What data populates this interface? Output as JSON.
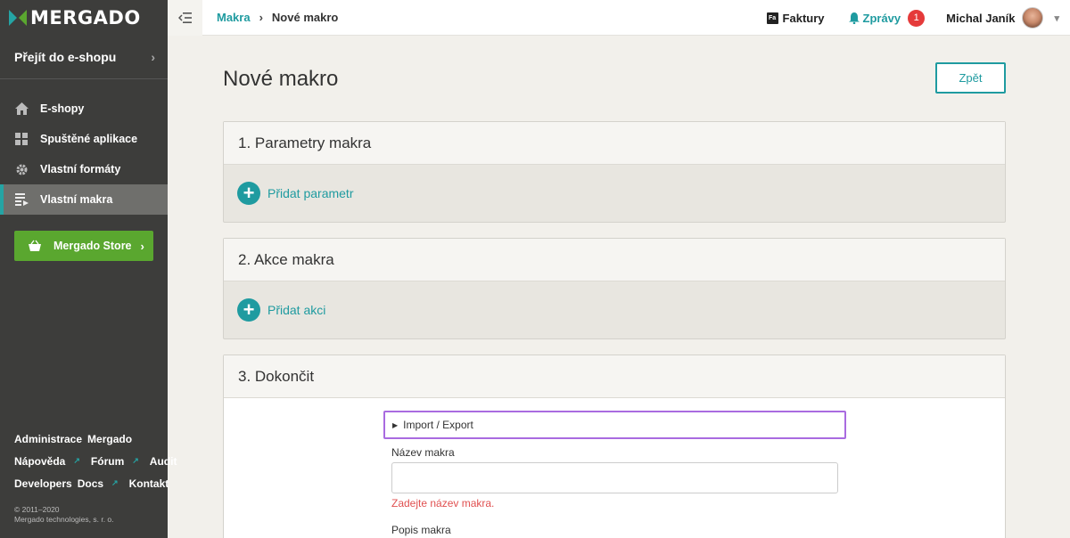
{
  "app": {
    "logo_text": "MERGADO"
  },
  "sidebar": {
    "shop_link": "Přejít do e-shopu",
    "items": [
      {
        "label": "E-shopy",
        "icon": "home-icon"
      },
      {
        "label": "Spuštěné aplikace",
        "icon": "grid-icon"
      },
      {
        "label": "Vlastní formáty",
        "icon": "gear-icon"
      },
      {
        "label": "Vlastní makra",
        "icon": "macro-list-icon",
        "active": true
      }
    ],
    "store_button": "Mergado Store",
    "footer_links": {
      "row1": [
        "Administrace",
        "Mergado"
      ],
      "row2": [
        "Nápověda",
        "Fórum",
        "Audit"
      ],
      "row3": [
        "Developers",
        "Docs",
        "Kontakt"
      ]
    },
    "copyright_years": "© 2011–2020",
    "copyright_company": "Mergado technologies, s. r. o."
  },
  "topbar": {
    "breadcrumb": {
      "parent": "Makra",
      "current": "Nové makro"
    },
    "faktury_icon_text": "Fa",
    "faktury": "Faktury",
    "zpravy": "Zprávy",
    "zpravy_count": "1",
    "user_name": "Michal Janík"
  },
  "main": {
    "title": "Nové makro",
    "back_button": "Zpět",
    "section1": {
      "title": "1. Parametry makra",
      "add_label": "Přidat parametr"
    },
    "section2": {
      "title": "2. Akce makra",
      "add_label": "Přidat akci"
    },
    "section3": {
      "title": "3. Dokončit",
      "import_export": "Import / Export",
      "name_label": "Název makra",
      "name_value": "",
      "name_error": "Zadejte název makra.",
      "description_label": "Popis makra"
    }
  },
  "colors": {
    "accent": "#1f9ba0",
    "sidebar": "#3d3d3b",
    "store_green": "#5aa72f",
    "error": "#e05050",
    "badge": "#e53a3a"
  }
}
